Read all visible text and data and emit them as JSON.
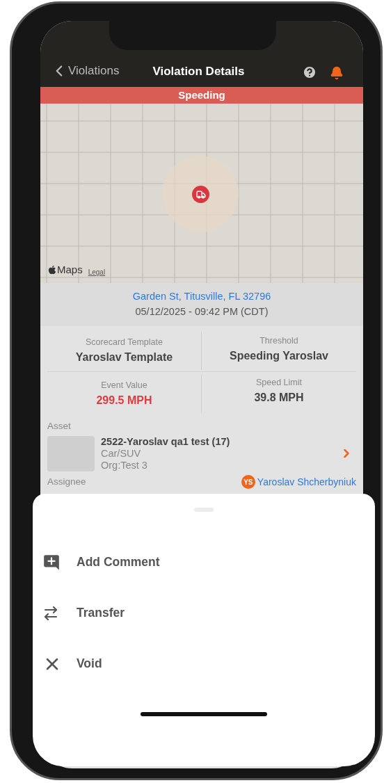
{
  "nav": {
    "back_label": "Violations",
    "title": "Violation Details"
  },
  "banner": {
    "label": "Speeding"
  },
  "map": {
    "attribution": "Maps",
    "legal": "Legal"
  },
  "location": {
    "address": "Garden St, Titusville, FL 32796",
    "datetime": "05/12/2025 - 09:42 PM (CDT)"
  },
  "stats": [
    {
      "label": "Scorecard Template",
      "value": "Yaroslav Template",
      "alert": false
    },
    {
      "label": "Threshold",
      "value": "Speeding Yaroslav",
      "alert": false
    },
    {
      "label": "Event Value",
      "value": "299.5 MPH",
      "alert": true
    },
    {
      "label": "Speed Limit",
      "value": "39.8 MPH",
      "alert": false
    }
  ],
  "asset": {
    "section_label": "Asset",
    "name": "2522-Yaroslav qa1 test (17)",
    "type": "Car/SUV",
    "org": "Org:Test 3"
  },
  "assignee": {
    "section_label": "Assignee",
    "initials": "YS",
    "name": "Yaroslav Shcherbyniuk"
  },
  "actions": [
    {
      "kind": "comment",
      "label": "Add Comment"
    },
    {
      "kind": "transfer",
      "label": "Transfer"
    },
    {
      "kind": "void",
      "label": "Void"
    }
  ]
}
